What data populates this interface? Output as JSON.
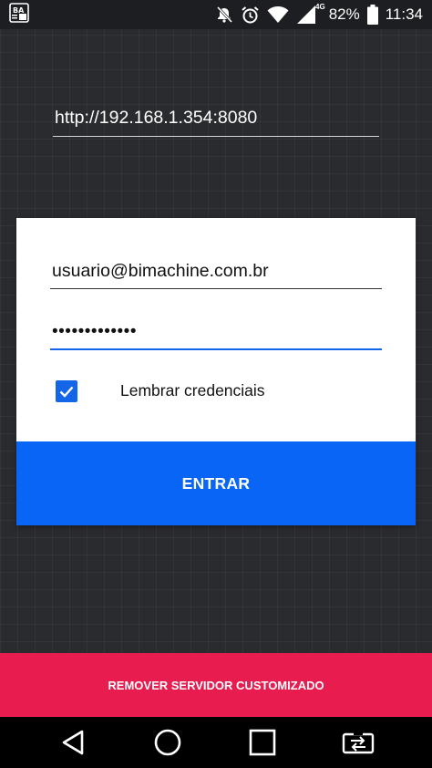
{
  "status_bar": {
    "network_type": "4G",
    "battery_percent": "82%",
    "time": "11:34",
    "icons": [
      "notification-app-icon",
      "mute-icon",
      "alarm-icon",
      "wifi-icon",
      "cellular-signal-icon",
      "battery-icon"
    ]
  },
  "server": {
    "url": "http://192.168.1.354:8080"
  },
  "login": {
    "email": "usuario@bimachine.com.br",
    "password_mask": "•••••••••••••",
    "remember_label": "Lembrar credenciais",
    "remember_checked": true,
    "submit_label": "ENTRAR"
  },
  "footer": {
    "remove_server_label": "REMOVER SERVIDOR CUSTOMIZADO"
  },
  "nav_bar": {
    "icons": [
      "back-icon",
      "home-icon",
      "recents-icon",
      "screen-rotate-icon"
    ]
  },
  "colors": {
    "primary": "#0965f6",
    "accent": "#e81c4f",
    "background": "#2a2b2f"
  }
}
